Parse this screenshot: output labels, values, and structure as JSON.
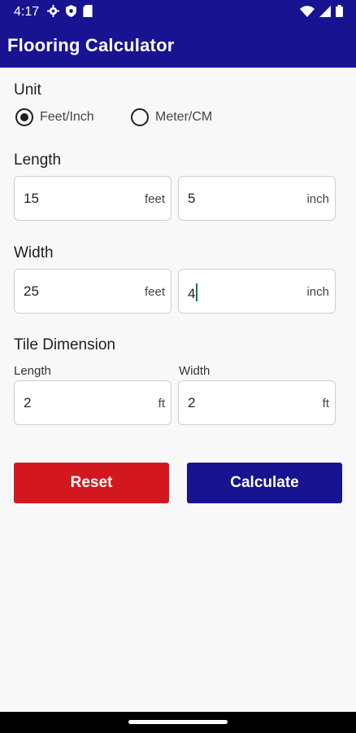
{
  "status_bar": {
    "time": "4:17",
    "icons_left": [
      "gear-icon",
      "shield-icon",
      "sd-card-icon"
    ],
    "icons_right": [
      "wifi-icon",
      "signal-icon",
      "battery-icon"
    ]
  },
  "app": {
    "title": "Flooring Calculator",
    "primary_color": "#171391",
    "reset_color": "#d2181e"
  },
  "unit": {
    "label": "Unit",
    "options": [
      {
        "label": "Feet/Inch",
        "selected": true
      },
      {
        "label": "Meter/CM",
        "selected": false
      }
    ]
  },
  "length": {
    "label": "Length",
    "feet_value": "15",
    "feet_unit": "feet",
    "inch_value": "5",
    "inch_unit": "inch"
  },
  "width": {
    "label": "Width",
    "feet_value": "25",
    "feet_unit": "feet",
    "inch_value": "4",
    "inch_unit": "inch"
  },
  "tile": {
    "label": "Tile Dimension",
    "length_label": "Length",
    "length_value": "2",
    "length_unit": "ft",
    "width_label": "Width",
    "width_value": "2",
    "width_unit": "ft"
  },
  "buttons": {
    "reset": "Reset",
    "calculate": "Calculate"
  }
}
